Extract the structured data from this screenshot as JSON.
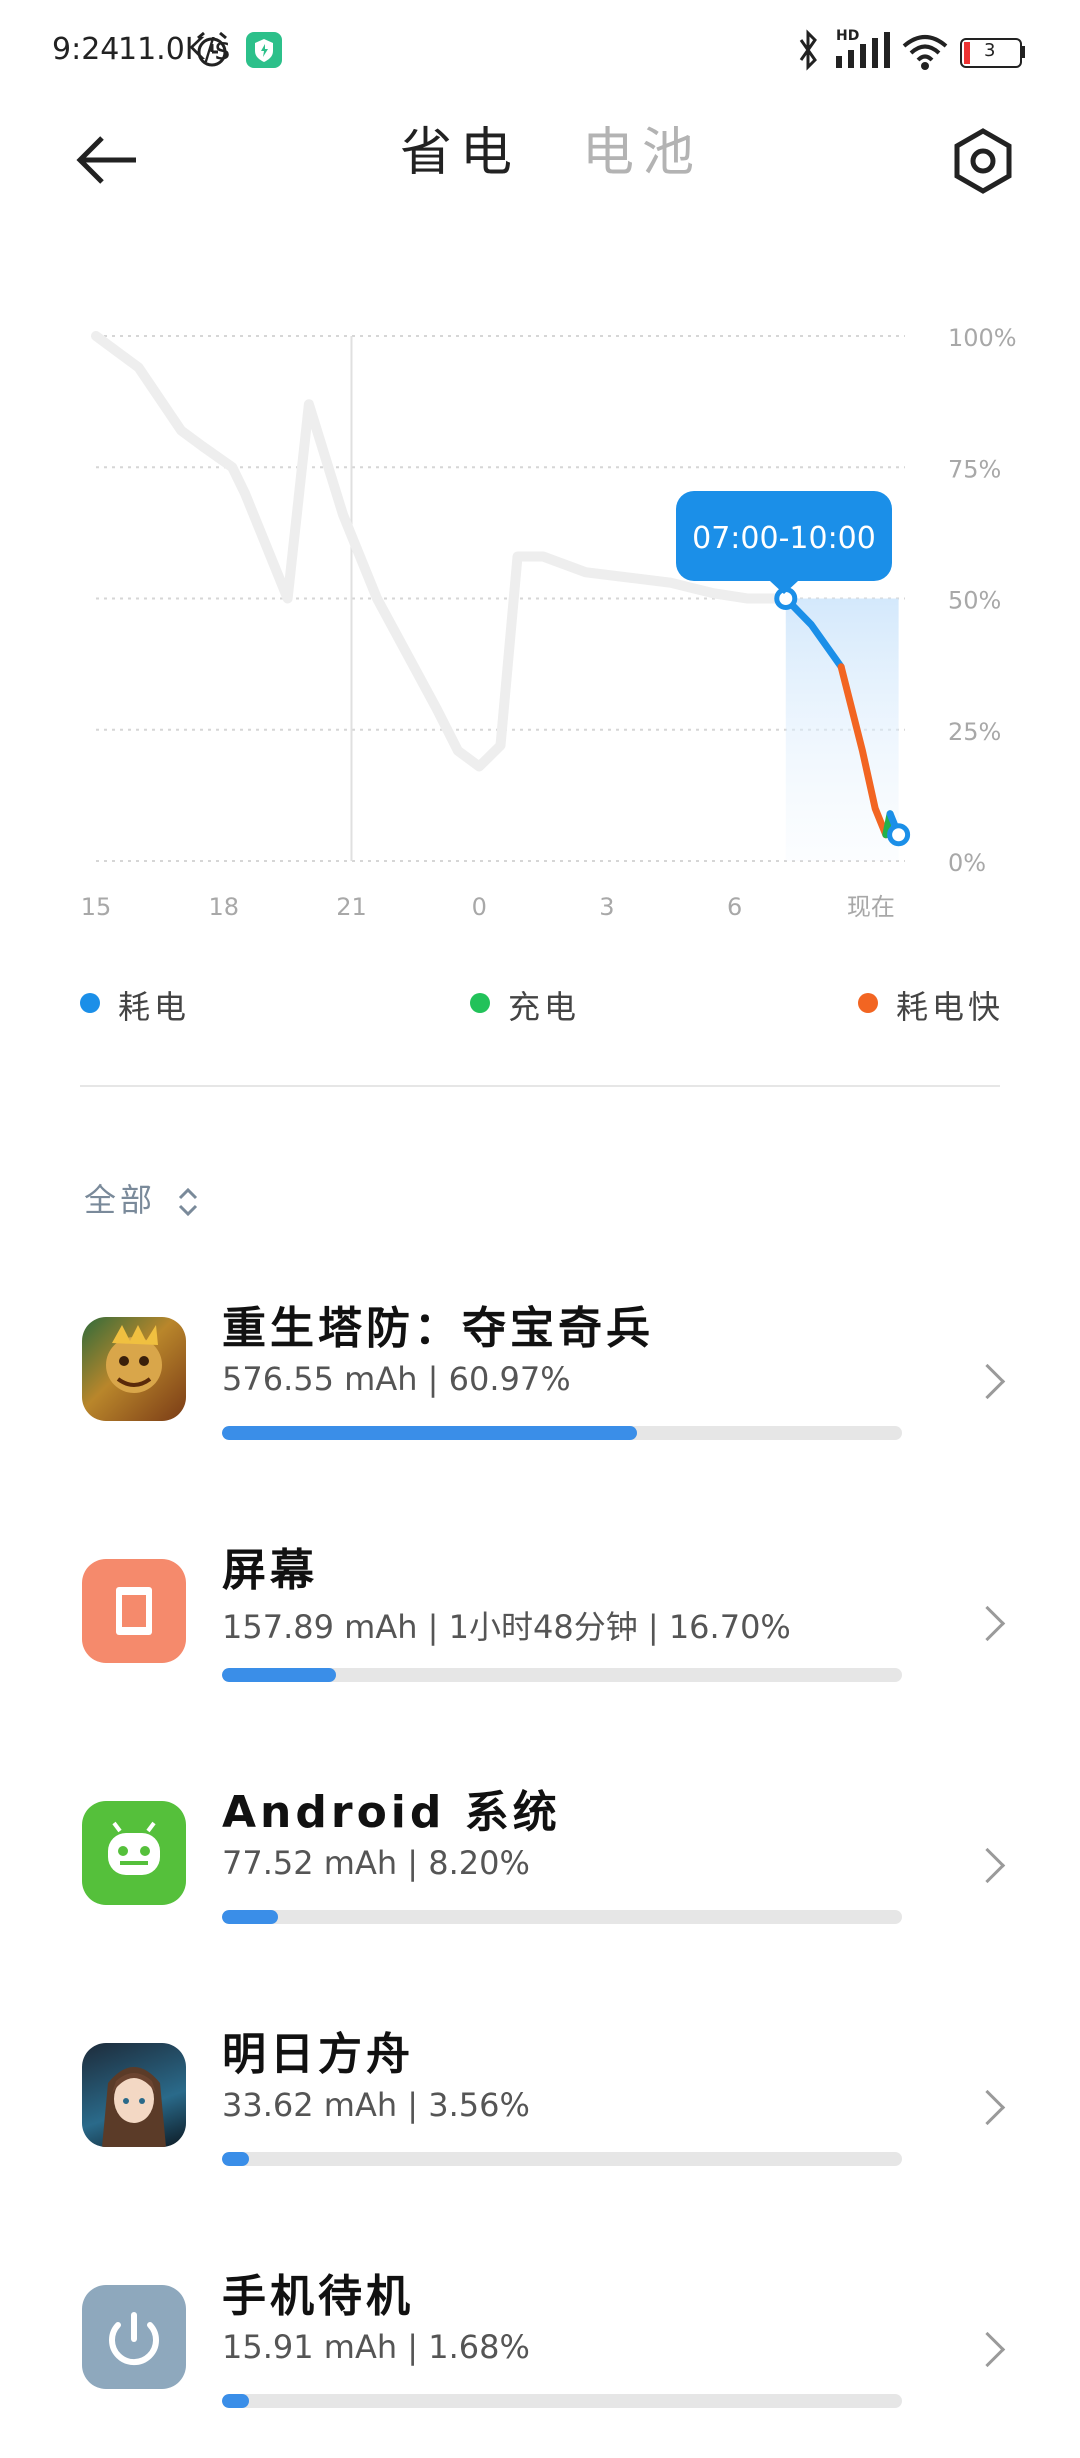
{
  "status_bar": {
    "time": "9:24",
    "speed": "11.0K/s",
    "network": "HD",
    "battery_level": "3"
  },
  "header": {
    "tabs": [
      {
        "label": "省电",
        "active": true
      },
      {
        "label": "电池",
        "active": false
      }
    ]
  },
  "chart_data": {
    "type": "line",
    "x_ticks": [
      "15",
      "18",
      "21",
      "0",
      "3",
      "6",
      "现在"
    ],
    "y_ticks": [
      "100%",
      "75%",
      "50%",
      "25%",
      "0%"
    ],
    "ylim": [
      0,
      100
    ],
    "grid": true,
    "tooltip": "07:00-10:00",
    "series": [
      {
        "color": "#eeeeee",
        "x": [
          0,
          1,
          1.5,
          2,
          2.5,
          3.2,
          3.5,
          4.5,
          5,
          5.8,
          6.3,
          6.6,
          7,
          7.4,
          8,
          8.5,
          9,
          9.5,
          9.9,
          10.5,
          11.5,
          12.5,
          13.5,
          14,
          14.5,
          15.3,
          16.2
        ],
        "y": [
          100,
          94,
          88,
          82,
          79,
          75,
          70,
          50,
          87,
          66,
          56,
          50,
          44,
          38,
          29,
          21,
          18,
          22,
          58,
          58,
          55,
          54,
          53,
          52,
          51,
          50,
          50
        ]
      },
      {
        "color": "#1b8fe8",
        "x": [
          16.2,
          16.8,
          17.5
        ],
        "y": [
          50,
          45,
          37
        ]
      },
      {
        "color": "#f26522",
        "x": [
          17.5,
          18.0,
          18.3,
          18.55
        ],
        "y": [
          37,
          21,
          10,
          5
        ]
      },
      {
        "color": "#22b24c",
        "x": [
          18.55,
          18.65
        ],
        "y": [
          5,
          9
        ]
      },
      {
        "color": "#1b8fe8",
        "x": [
          18.65,
          18.85
        ],
        "y": [
          9,
          5
        ]
      }
    ],
    "legend": [
      {
        "label": "耗电",
        "color": "#1b8fe8"
      },
      {
        "label": "充电",
        "color": "#22c25a"
      },
      {
        "label": "耗电快",
        "color": "#f26522"
      }
    ]
  },
  "filter": {
    "label": "全部"
  },
  "apps": [
    {
      "name": "重生塔防：夺宝奇兵",
      "stat": "576.55 mAh | 60.97%",
      "percent": 60.97,
      "icon": "game-tower-defense-icon"
    },
    {
      "name": "屏幕",
      "stat": "157.89 mAh | 1小时48分钟 | 16.70%",
      "percent": 16.7,
      "icon": "screen-icon"
    },
    {
      "name": "Android 系统",
      "stat": "77.52 mAh | 8.20%",
      "percent": 8.2,
      "icon": "android-icon"
    },
    {
      "name": "明日方舟",
      "stat": "33.62 mAh | 3.56%",
      "percent": 3.56,
      "icon": "arknights-icon"
    },
    {
      "name": "手机待机",
      "stat": "15.91 mAh | 1.68%",
      "percent": 1.68,
      "icon": "standby-power-icon"
    }
  ]
}
